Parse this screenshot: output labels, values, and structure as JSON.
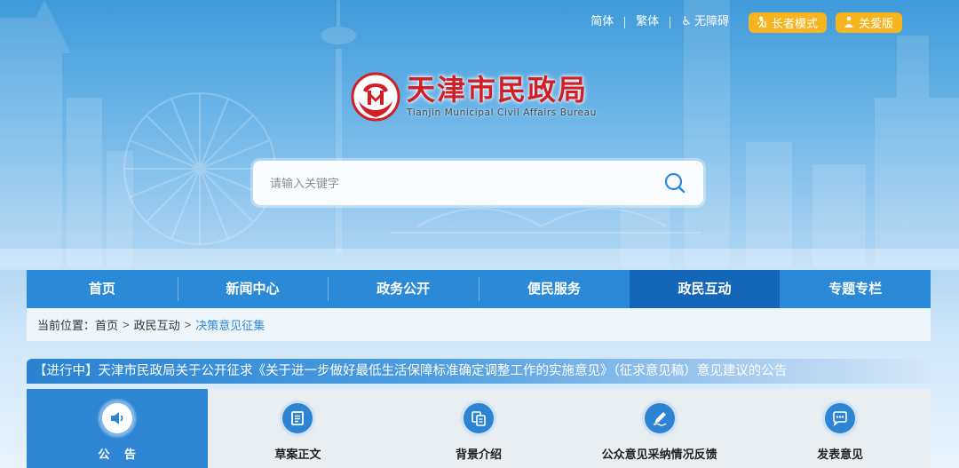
{
  "top_links": {
    "simplified": "简体",
    "traditional": "繁体",
    "accessibility": "无障碍",
    "elder_mode": "长者模式",
    "care_mode": "关爱版"
  },
  "logo": {
    "title": "天津市民政局",
    "subtitle": "Tianjin Municipal Civil Affairs Bureau"
  },
  "search": {
    "placeholder": "请输入关键字"
  },
  "nav": {
    "items": [
      "首页",
      "新闻中心",
      "政务公开",
      "便民服务",
      "政民互动",
      "专题专栏"
    ],
    "active": "政民互动"
  },
  "breadcrumb": {
    "prefix": "当前位置：",
    "items": [
      "首页",
      "政民互动",
      "决策意见征集"
    ]
  },
  "notice": {
    "title": "【进行中】天津市民政局关于公开征求《关于进一步做好最低生活保障标准确定调整工作的实施意见》（征求意见稿）意见建议的公告"
  },
  "tabs": {
    "items": [
      "公 告",
      "草案正文",
      "背景介绍",
      "公众意见采纳情况反馈",
      "发表意见"
    ],
    "active": "公 告",
    "icons": [
      "speaker-icon",
      "document-icon",
      "files-icon",
      "pen-icon",
      "chat-icon"
    ]
  },
  "colors": {
    "nav_bg": "#2b8ad8",
    "nav_active": "#1366b8",
    "logo_red": "#d01f25",
    "pill_yellow": "#f6b51f",
    "breadcrumb_current": "#2b8ad8"
  }
}
